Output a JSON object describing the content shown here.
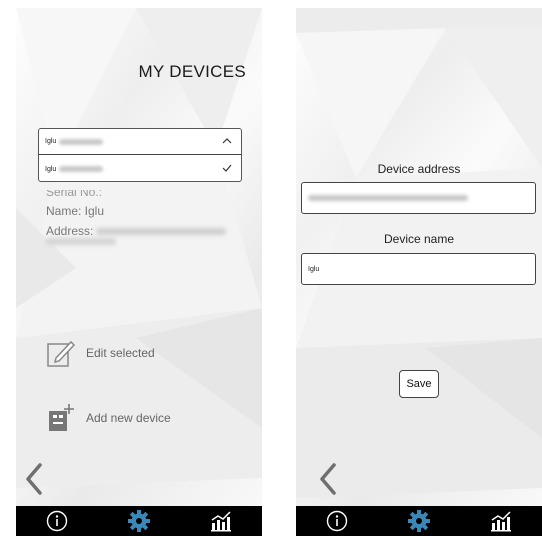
{
  "left_screen": {
    "title": "MY DEVICES",
    "dropdown": {
      "selected_label": "Iglu",
      "option_label": "Iglu"
    },
    "serial_label": "Serial No.:",
    "name_line": "Name: Iglu",
    "address_label": "Address:",
    "edit_label": "Edit selected",
    "add_label": "Add new device"
  },
  "right_screen": {
    "address_label": "Device address",
    "name_label": "Device name",
    "name_value": "Iglu",
    "save_label": "Save"
  },
  "icons": [
    "chevron-up-icon",
    "checkmark-icon",
    "edit-icon",
    "add-device-icon",
    "back-arrow-icon",
    "info-icon",
    "gear-icon",
    "chart-icon"
  ],
  "colors": {
    "accent": "#3a88b8",
    "bottom_bar": "#000000",
    "text_muted": "#777777"
  }
}
